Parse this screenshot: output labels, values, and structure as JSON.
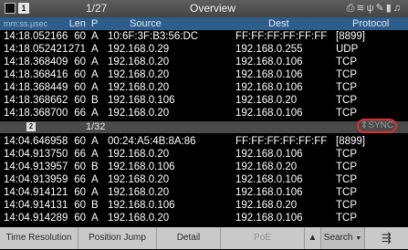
{
  "titlebar": {
    "page": "1/27",
    "title": "Overview",
    "window_num": "1",
    "icons": [
      "print-icon",
      "wifi-icon",
      "usb-icon",
      "wrench-icon",
      "battery-icon",
      "bell-icon"
    ]
  },
  "columns": {
    "time": "mm:ss.μsec",
    "len": "Len",
    "p": "P",
    "source": "Source",
    "dest": "Dest",
    "protocol": "Protocol"
  },
  "pane1_rows": [
    {
      "time": "14:18.052166",
      "len": "60",
      "p": "A",
      "source": "10:6F:3F:B3:56:DC",
      "dest": "FF:FF:FF:FF:FF:FF",
      "protocol": "[8899]"
    },
    {
      "time": "14:18.052421",
      "len": "271",
      "p": "A",
      "source": "192.168.0.29",
      "dest": "192.168.0.255",
      "protocol": "UDP"
    },
    {
      "time": "14:18.368409",
      "len": "60",
      "p": "A",
      "source": "192.168.0.20",
      "dest": "192.168.0.106",
      "protocol": "TCP"
    },
    {
      "time": "14:18.368416",
      "len": "60",
      "p": "A",
      "source": "192.168.0.20",
      "dest": "192.168.0.106",
      "protocol": "TCP"
    },
    {
      "time": "14:18.368449",
      "len": "60",
      "p": "A",
      "source": "192.168.0.20",
      "dest": "192.168.0.106",
      "protocol": "TCP"
    },
    {
      "time": "14:18.368662",
      "len": "60",
      "p": "B",
      "source": "192.168.0.106",
      "dest": "192.168.0.20",
      "protocol": "TCP"
    },
    {
      "time": "14:18.368700",
      "len": "66",
      "p": "A",
      "source": "192.168.0.20",
      "dest": "192.168.0.106",
      "protocol": "TCP"
    }
  ],
  "pane2": {
    "window_num": "2",
    "page": "1/32",
    "sync_label": "SYNC"
  },
  "pane2_rows": [
    {
      "time": "14:04.646958",
      "len": "60",
      "p": "A",
      "source": "00:24:A5:4B:8A:86",
      "dest": "FF:FF:FF:FF:FF:FF",
      "protocol": "[8899]"
    },
    {
      "time": "14:04.913750",
      "len": "66",
      "p": "A",
      "source": "192.168.0.20",
      "dest": "192.168.0.106",
      "protocol": "TCP"
    },
    {
      "time": "14:04.913957",
      "len": "60",
      "p": "B",
      "source": "192.168.0.106",
      "dest": "192.168.0.20",
      "protocol": "TCP"
    },
    {
      "time": "14:04.913959",
      "len": "66",
      "p": "A",
      "source": "192.168.0.20",
      "dest": "192.168.0.106",
      "protocol": "TCP"
    },
    {
      "time": "14:04.914121",
      "len": "60",
      "p": "A",
      "source": "192.168.0.20",
      "dest": "192.168.0.106",
      "protocol": "TCP"
    },
    {
      "time": "14:04.914131",
      "len": "60",
      "p": "B",
      "source": "192.168.0.106",
      "dest": "192.168.0.20",
      "protocol": "TCP"
    },
    {
      "time": "14:04.914289",
      "len": "60",
      "p": "A",
      "source": "192.168.0.20",
      "dest": "192.168.0.106",
      "protocol": "TCP"
    }
  ],
  "toolbar": {
    "time_resolution": "Time Resolution",
    "position_jump": "Position Jump",
    "detail": "Detail",
    "poe": "PoE",
    "up_arrow": "▲",
    "search": "Search",
    "search_arrow": "▼",
    "menu_icon": "⇶"
  },
  "colors": {
    "header_blue": "#2e5d8a",
    "sync_ring": "#e0302f",
    "toolbar_bg": "#c9c9c9"
  }
}
